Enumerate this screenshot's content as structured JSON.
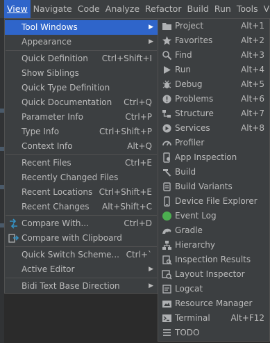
{
  "menubar": {
    "items": [
      {
        "label": "View",
        "active": true
      },
      {
        "label": "Navigate"
      },
      {
        "label": "Code"
      },
      {
        "label": "Analyze"
      },
      {
        "label": "Refactor"
      },
      {
        "label": "Build"
      },
      {
        "label": "Run"
      },
      {
        "label": "Tools"
      },
      {
        "label": "VCS"
      }
    ]
  },
  "view_menu": {
    "items": [
      {
        "label": "Tool Windows",
        "shortcut": "",
        "submenu": true,
        "selected": true
      },
      {
        "label": "Appearance",
        "shortcut": "",
        "submenu": true
      },
      {
        "label": "Quick Definition",
        "shortcut": "Ctrl+Shift+I"
      },
      {
        "label": "Show Siblings",
        "shortcut": ""
      },
      {
        "label": "Quick Type Definition",
        "shortcut": ""
      },
      {
        "label": "Quick Documentation",
        "shortcut": "Ctrl+Q"
      },
      {
        "label": "Parameter Info",
        "shortcut": "Ctrl+P"
      },
      {
        "label": "Type Info",
        "shortcut": "Ctrl+Shift+P"
      },
      {
        "label": "Context Info",
        "shortcut": "Alt+Q"
      },
      {
        "label": "Recent Files",
        "shortcut": "Ctrl+E"
      },
      {
        "label": "Recently Changed Files",
        "shortcut": ""
      },
      {
        "label": "Recent Locations",
        "shortcut": "Ctrl+Shift+E"
      },
      {
        "label": "Recent Changes",
        "shortcut": "Alt+Shift+C"
      },
      {
        "label": "Compare With...",
        "shortcut": "Ctrl+D",
        "icon": "compare-icon"
      },
      {
        "label": "Compare with Clipboard",
        "shortcut": "",
        "icon": "compare-clipboard-icon"
      },
      {
        "label": "Quick Switch Scheme...",
        "shortcut": "Ctrl+`"
      },
      {
        "label": "Active Editor",
        "shortcut": "",
        "submenu": true
      },
      {
        "label": "Bidi Text Base Direction",
        "shortcut": "",
        "submenu": true
      }
    ]
  },
  "tool_windows": {
    "items": [
      {
        "label": "Project",
        "shortcut": "Alt+1",
        "icon": "folder-icon"
      },
      {
        "label": "Favorites",
        "shortcut": "Alt+2",
        "icon": "star-icon"
      },
      {
        "label": "Find",
        "shortcut": "Alt+3",
        "icon": "search-icon"
      },
      {
        "label": "Run",
        "shortcut": "Alt+4",
        "icon": "run-icon"
      },
      {
        "label": "Debug",
        "shortcut": "Alt+5",
        "icon": "bug-icon"
      },
      {
        "label": "Problems",
        "shortcut": "Alt+6",
        "icon": "problems-icon"
      },
      {
        "label": "Structure",
        "shortcut": "Alt+7",
        "icon": "structure-icon"
      },
      {
        "label": "Services",
        "shortcut": "Alt+8",
        "icon": "services-icon"
      },
      {
        "label": "Profiler",
        "shortcut": "",
        "icon": "profiler-icon"
      },
      {
        "label": "App Inspection",
        "shortcut": "",
        "icon": "app-inspection-icon"
      },
      {
        "label": "Build",
        "shortcut": "",
        "icon": "hammer-icon"
      },
      {
        "label": "Build Variants",
        "shortcut": "",
        "icon": "build-variants-icon"
      },
      {
        "label": "Device File Explorer",
        "shortcut": "",
        "icon": "device-file-icon"
      },
      {
        "label": "Event Log",
        "shortcut": "",
        "icon": "event-log-icon"
      },
      {
        "label": "Gradle",
        "shortcut": "",
        "icon": "gradle-icon"
      },
      {
        "label": "Hierarchy",
        "shortcut": "",
        "icon": "hierarchy-icon"
      },
      {
        "label": "Inspection Results",
        "shortcut": "",
        "icon": "inspection-icon"
      },
      {
        "label": "Layout Inspector",
        "shortcut": "",
        "icon": "layout-inspector-icon"
      },
      {
        "label": "Logcat",
        "shortcut": "",
        "icon": "logcat-icon"
      },
      {
        "label": "Resource Manager",
        "shortcut": "",
        "icon": "resource-manager-icon"
      },
      {
        "label": "Terminal",
        "shortcut": "Alt+F12",
        "icon": "terminal-icon"
      },
      {
        "label": "TODO",
        "shortcut": "",
        "icon": "todo-icon"
      }
    ]
  },
  "colors": {
    "menu_bg": "#3c3f41",
    "selection": "#2f65ca",
    "text": "#bbbbbb"
  }
}
